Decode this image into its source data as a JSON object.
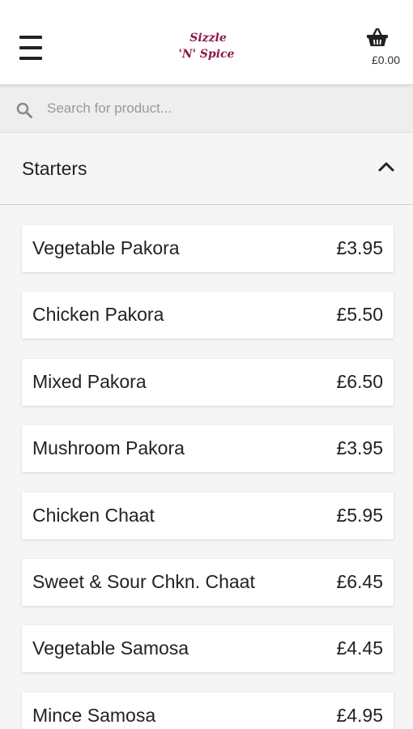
{
  "header": {
    "logo_line1": "Sizzle",
    "logo_line2": "'N' Spice",
    "cart_total": "£0.00"
  },
  "search": {
    "placeholder": "Search for product..."
  },
  "category": {
    "title": "Starters",
    "expanded": true
  },
  "items": [
    {
      "name": "Vegetable Pakora",
      "price": "£3.95"
    },
    {
      "name": "Chicken Pakora",
      "price": "£5.50"
    },
    {
      "name": "Mixed Pakora",
      "price": "£6.50"
    },
    {
      "name": "Mushroom Pakora",
      "price": "£3.95"
    },
    {
      "name": "Chicken Chaat",
      "price": "£5.95"
    },
    {
      "name": "Sweet & Sour Chkn. Chaat",
      "price": "£6.45"
    },
    {
      "name": "Vegetable Samosa",
      "price": "£4.45"
    },
    {
      "name": "Mince Samosa",
      "price": "£4.95"
    }
  ],
  "colors": {
    "logo": "#8b1a4a",
    "background": "#f5f5f5",
    "card": "#ffffff"
  }
}
